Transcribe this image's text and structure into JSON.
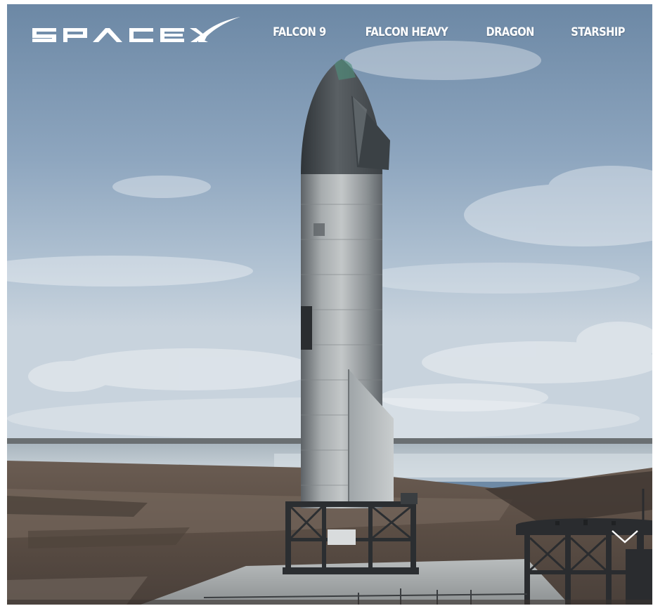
{
  "brand": {
    "logo_text": "SPACEX"
  },
  "nav": {
    "items": [
      {
        "label": "FALCON 9"
      },
      {
        "label": "FALCON HEAVY"
      },
      {
        "label": "DRAGON"
      },
      {
        "label": "STARSHIP"
      }
    ]
  },
  "hero": {
    "image_subject": "starship-on-launch-stand",
    "scroll_icon": "chevron-down-icon"
  },
  "colors": {
    "nav_text": "#ffffff",
    "sky_top": "#6f8aa7",
    "sky_mid": "#a8bccf",
    "horizon": "#c7d3dd",
    "ground": "#5a4f47",
    "rocket_steel": "#9ea4a7"
  }
}
